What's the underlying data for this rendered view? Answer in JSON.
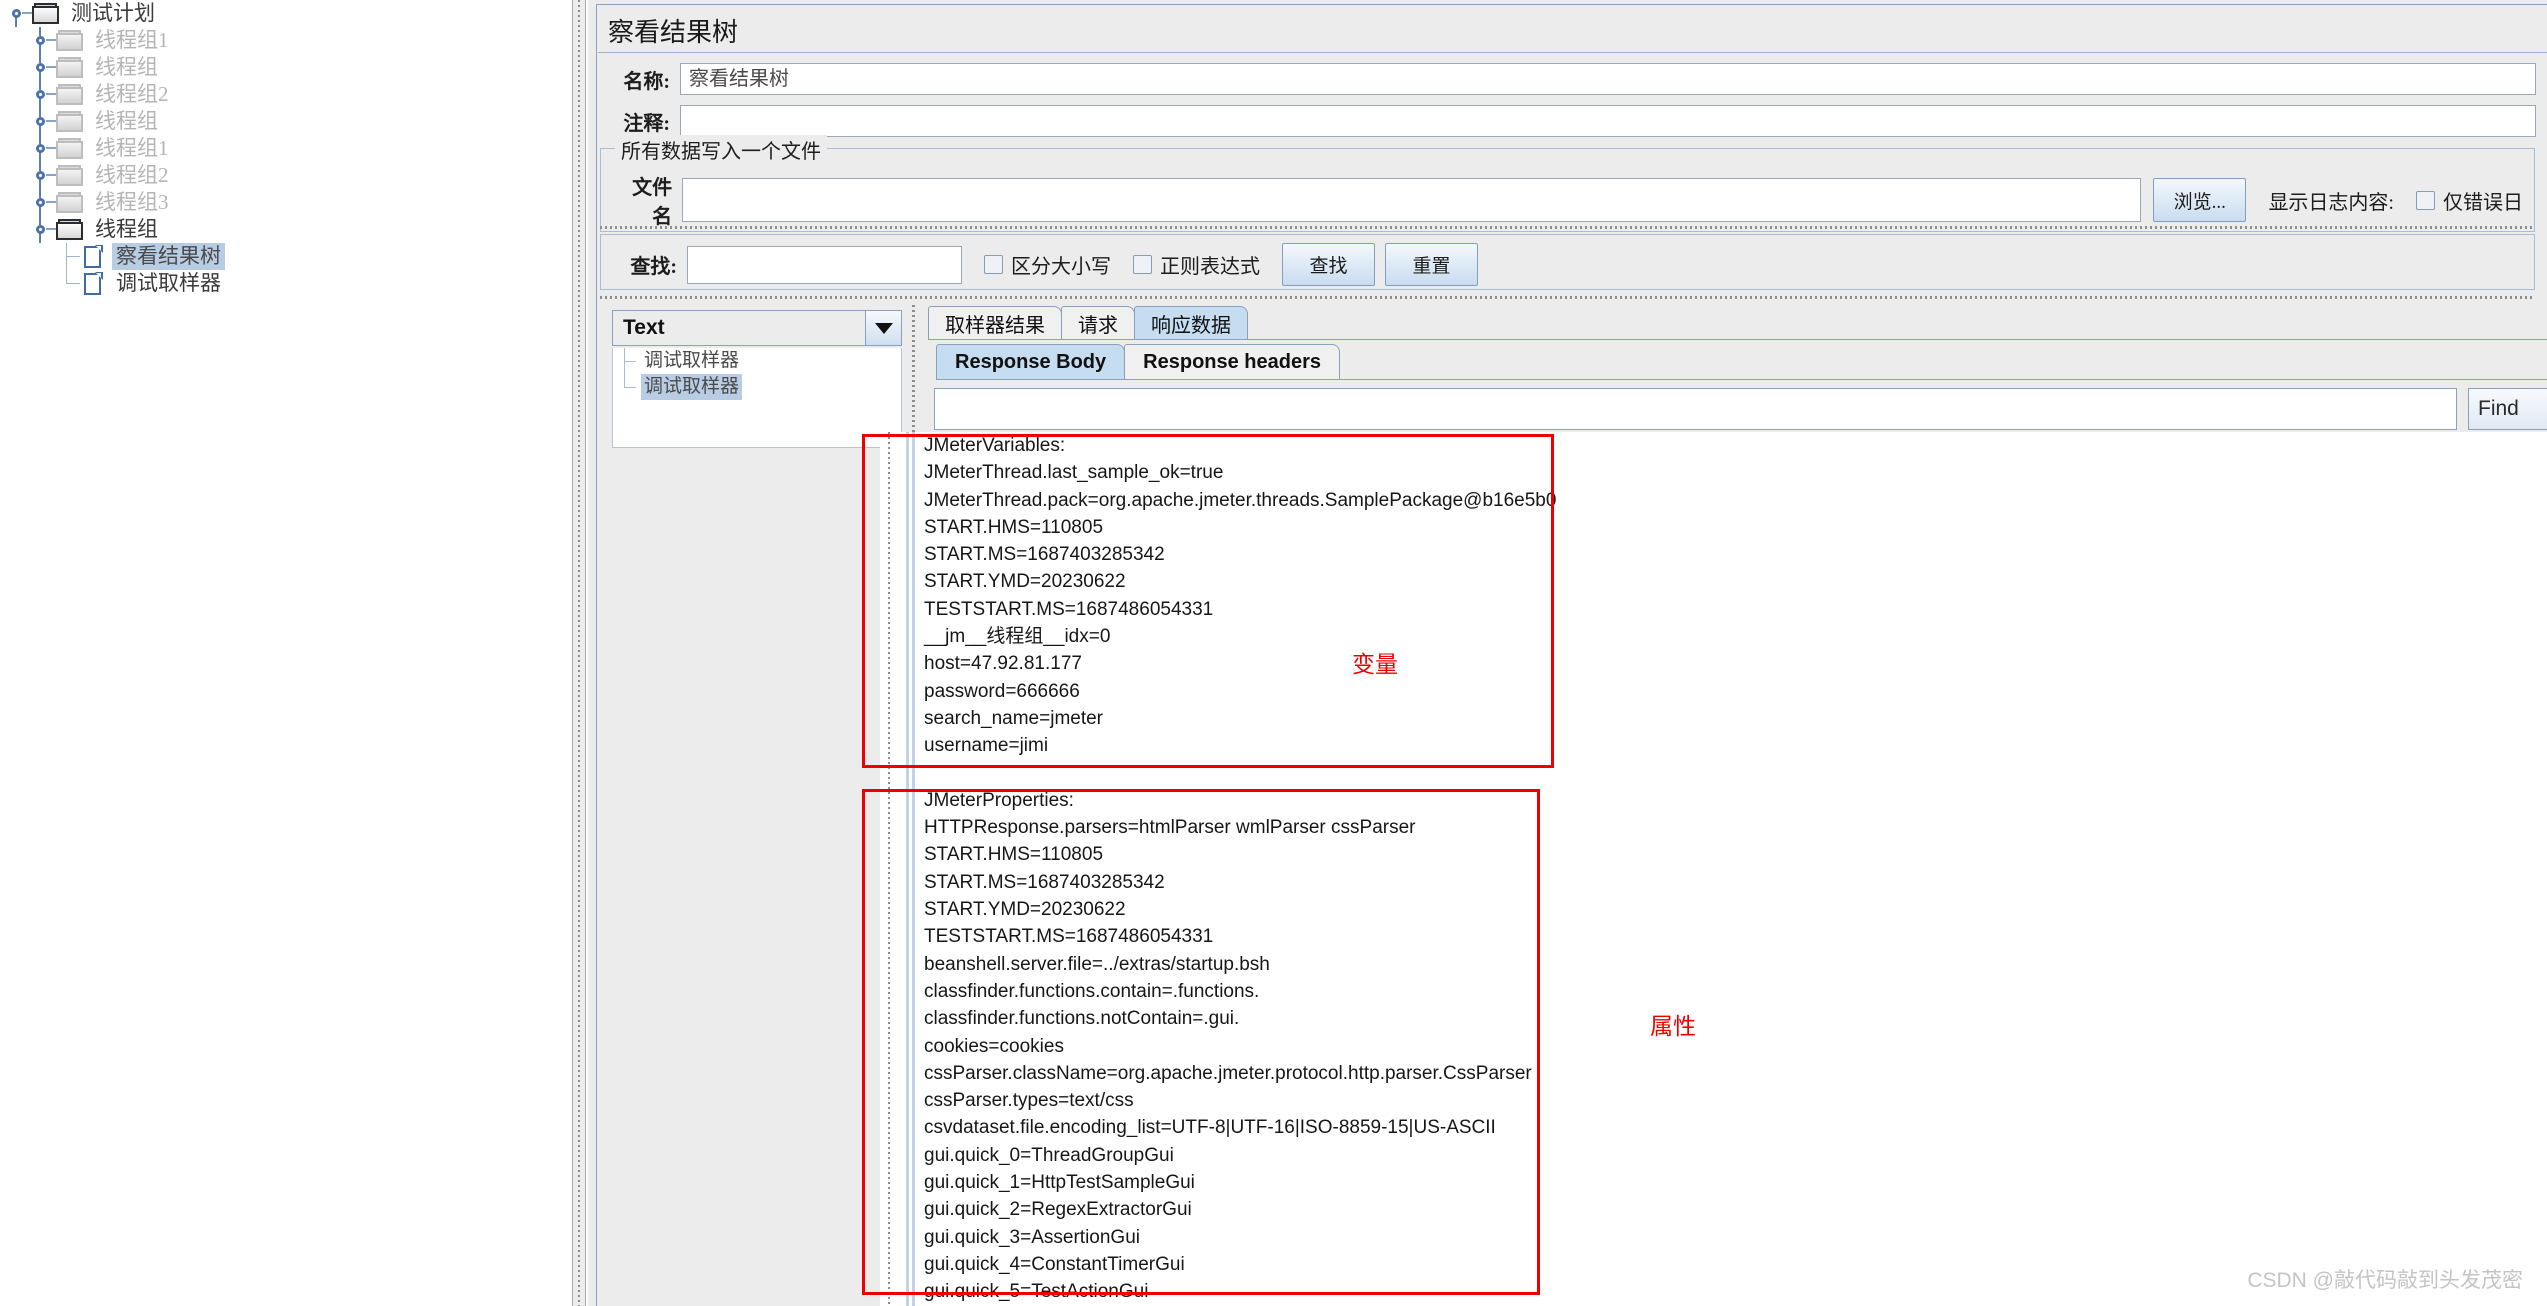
{
  "tree": {
    "root": {
      "label": "测试计划",
      "icon": "folder-icon"
    },
    "items": [
      {
        "label": "线程组1",
        "dim": true,
        "icon": "folder-icon"
      },
      {
        "label": "线程组",
        "dim": true,
        "icon": "folder-icon"
      },
      {
        "label": "线程组2",
        "dim": true,
        "icon": "folder-icon"
      },
      {
        "label": "线程组",
        "dim": true,
        "icon": "folder-icon"
      },
      {
        "label": "线程组1",
        "dim": true,
        "icon": "folder-icon"
      },
      {
        "label": "线程组2",
        "dim": true,
        "icon": "folder-icon"
      },
      {
        "label": "线程组3",
        "dim": true,
        "icon": "folder-icon"
      },
      {
        "label": "线程组",
        "dim": false,
        "icon": "folder-icon"
      }
    ],
    "children": [
      {
        "label": "察看结果树",
        "selected": true,
        "icon": "file-icon"
      },
      {
        "label": "调试取样器",
        "selected": false,
        "icon": "file-icon"
      }
    ]
  },
  "panel": {
    "title": "察看结果树",
    "name_label": "名称:",
    "name_value": "察看结果树",
    "comment_label": "注释:",
    "comment_value": ""
  },
  "file_group": {
    "title": "所有数据写入一个文件",
    "filename_label": "文件名",
    "filename_value": "",
    "browse_button": "浏览...",
    "log_label": "显示日志内容:",
    "errors_only_label": "仅错误日"
  },
  "search_bar": {
    "label": "查找:",
    "value": "",
    "case_sensitive_label": "区分大小写",
    "regex_label": "正则表达式",
    "find_button": "查找",
    "reset_button": "重置"
  },
  "left_lower": {
    "combo_value": "Text",
    "tree_items": [
      {
        "label": "调试取样器",
        "selected": false
      },
      {
        "label": "调试取样器",
        "selected": true
      }
    ]
  },
  "tabs": {
    "main": [
      {
        "label": "取样器结果",
        "active": false
      },
      {
        "label": "请求",
        "active": false
      },
      {
        "label": "响应数据",
        "active": true
      }
    ],
    "sub": [
      {
        "label": "Response Body",
        "active": true
      },
      {
        "label": "Response headers",
        "active": false
      }
    ]
  },
  "response_search": {
    "value": "",
    "find_button": "Find"
  },
  "response_body": {
    "variables_lines": [
      "JMeterVariables:",
      "JMeterThread.last_sample_ok=true",
      "JMeterThread.pack=org.apache.jmeter.threads.SamplePackage@b16e5b0",
      "START.HMS=110805",
      "START.MS=1687403285342",
      "START.YMD=20230622",
      "TESTSTART.MS=1687486054331",
      "__jm__线程组__idx=0",
      "host=47.92.81.177",
      "password=666666",
      "search_name=jmeter",
      "username=jimi"
    ],
    "blank_lines_between": 1,
    "properties_lines": [
      "JMeterProperties:",
      "HTTPResponse.parsers=htmlParser wmlParser cssParser",
      "START.HMS=110805",
      "START.MS=1687403285342",
      "START.YMD=20230622",
      "TESTSTART.MS=1687486054331",
      "beanshell.server.file=../extras/startup.bsh",
      "classfinder.functions.contain=.functions.",
      "classfinder.functions.notContain=.gui.",
      "cookies=cookies",
      "cssParser.className=org.apache.jmeter.protocol.http.parser.CssParser",
      "cssParser.types=text/css",
      "csvdataset.file.encoding_list=UTF-8|UTF-16|ISO-8859-15|US-ASCII",
      "gui.quick_0=ThreadGroupGui",
      "gui.quick_1=HttpTestSampleGui",
      "gui.quick_2=RegexExtractorGui",
      "gui.quick_3=AssertionGui",
      "gui.quick_4=ConstantTimerGui",
      "gui.quick_5=TestActionGui"
    ]
  },
  "annotations": {
    "variables_label": "变量",
    "properties_label": "属性",
    "accent_red": "#ee0000"
  },
  "watermark": "CSDN @敲代码敲到头发茂密"
}
